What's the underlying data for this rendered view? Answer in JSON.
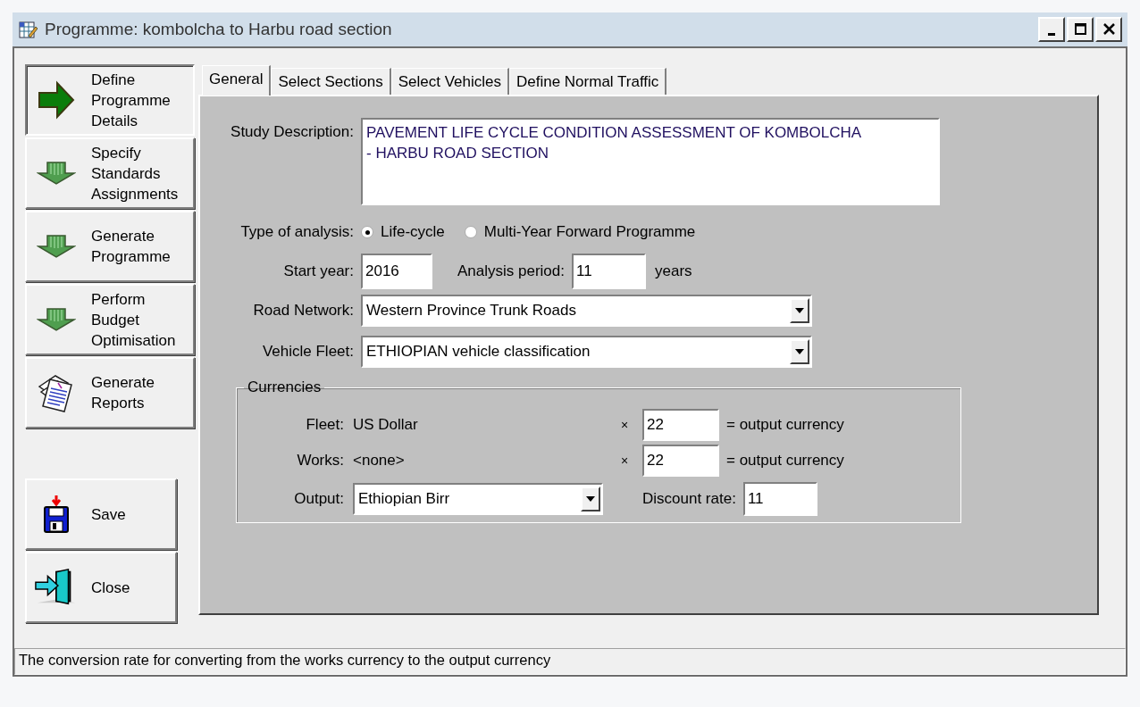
{
  "window": {
    "title": "Programme: kombolcha to Harbu road section"
  },
  "steps": [
    {
      "label": "Define Programme Details",
      "kind": "step",
      "selected": true
    },
    {
      "label": "Specify Standards Assignments",
      "kind": "step",
      "selected": false
    },
    {
      "label": "Generate Programme",
      "kind": "step",
      "selected": false
    },
    {
      "label": "Perform Budget Optimisation",
      "kind": "step",
      "selected": false
    },
    {
      "label": "Generate Reports",
      "kind": "report",
      "selected": false
    }
  ],
  "actions": [
    {
      "label": "Save",
      "kind": "save"
    },
    {
      "label": "Close",
      "kind": "close"
    }
  ],
  "tabs": [
    {
      "label": "General",
      "selected": true
    },
    {
      "label": "Select Sections",
      "selected": false
    },
    {
      "label": "Select Vehicles",
      "selected": false
    },
    {
      "label": "Define Normal Traffic",
      "selected": false
    }
  ],
  "form": {
    "study_description": {
      "label": "Study Description:",
      "value": "PAVEMENT LIFE CYCLE CONDITION ASSESSMENT OF KOMBOLCHA\n- HARBU ROAD SECTION"
    },
    "analysis_type": {
      "label": "Type of analysis:",
      "options": [
        {
          "label": "Life-cycle",
          "selected": true
        },
        {
          "label": "Multi-Year Forward Programme",
          "selected": false
        }
      ]
    },
    "start_year": {
      "label": "Start year:",
      "value": "2016"
    },
    "analysis_period": {
      "label": "Analysis period:",
      "value": "11",
      "unit": "years"
    },
    "road_network": {
      "label": "Road Network:",
      "value": "Western Province Trunk Roads"
    },
    "vehicle_fleet": {
      "label": "Vehicle Fleet:",
      "value": "ETHIOPIAN vehicle classification"
    },
    "currencies": {
      "title": "Currencies",
      "rows": [
        {
          "label": "Fleet:",
          "currency": "US Dollar",
          "sign": "×",
          "rate": "22",
          "suffix": "= output currency"
        },
        {
          "label": "Works:",
          "currency": "<none>",
          "sign": "×",
          "rate": "22",
          "suffix": "= output currency"
        }
      ],
      "output": {
        "label": "Output:",
        "value": "Ethiopian Birr"
      },
      "discount_rate": {
        "label": "Discount rate:",
        "value": "11"
      }
    }
  },
  "status_bar": {
    "text": "The conversion rate for converting from the works currency to the output currency"
  }
}
